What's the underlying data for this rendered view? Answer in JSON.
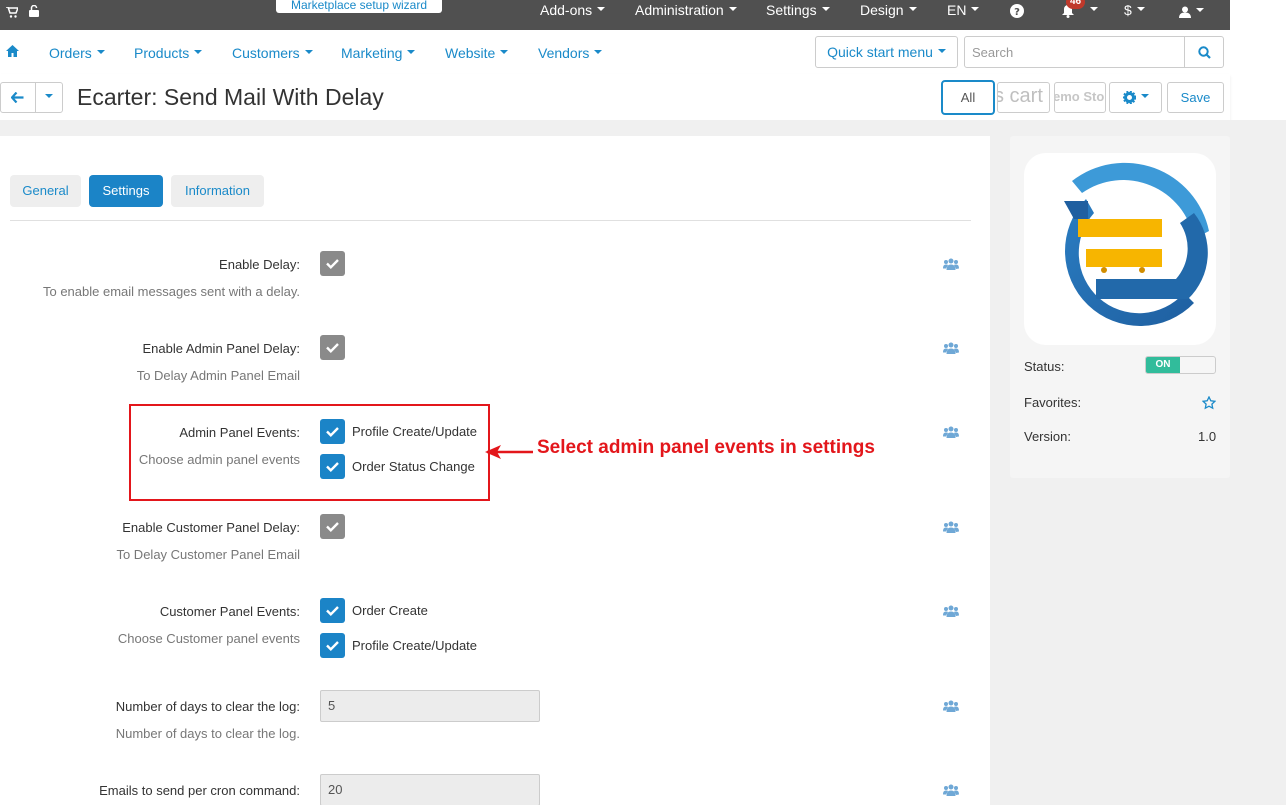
{
  "topbar": {
    "wizard_label": "Marketplace setup wizard",
    "menus": [
      "Add-ons",
      "Administration",
      "Settings",
      "Design",
      "EN",
      "$"
    ],
    "notification_count": "46"
  },
  "nav": {
    "items": [
      "Orders",
      "Products",
      "Customers",
      "Marketing",
      "Website",
      "Vendors"
    ],
    "quick_start": "Quick start menu",
    "search_placeholder": "Search"
  },
  "header": {
    "title": "Ecarter: Send Mail With Delay",
    "all_label": "All",
    "storefront_logo_1": "s cart",
    "storefront_logo_2": "emo Sto",
    "save_label": "Save"
  },
  "tabs": [
    {
      "label": "General",
      "active": false
    },
    {
      "label": "Settings",
      "active": true
    },
    {
      "label": "Information",
      "active": false
    }
  ],
  "settings": [
    {
      "label": "Enable Delay:",
      "help": "To enable email messages sent with a delay."
    },
    {
      "label": "Enable Admin Panel Delay:",
      "help": "To Delay Admin Panel Email"
    },
    {
      "label": "Admin Panel Events:",
      "help": "Choose admin panel events",
      "options": [
        "Profile Create/Update",
        "Order Status Change"
      ]
    },
    {
      "label": "Enable Customer Panel Delay:",
      "help": "To Delay Customer Panel Email"
    },
    {
      "label": "Customer Panel Events:",
      "help": "Choose Customer panel events",
      "options": [
        "Order Create",
        "Profile Create/Update"
      ]
    },
    {
      "label": "Number of days to clear the log:",
      "help": "Number of days to clear the log.",
      "value": "5"
    },
    {
      "label": "Emails to send per cron command:",
      "value": "20"
    }
  ],
  "annotation": "Select admin panel events in settings",
  "side": {
    "status_label": "Status:",
    "status_value": "ON",
    "favorites_label": "Favorites:",
    "version_label": "Version:",
    "version_value": "1.0"
  },
  "colors": {
    "accent": "#1b84c7",
    "annotation_red": "#e3161b",
    "status_on": "#31bc9b",
    "topbar": "#505050"
  }
}
